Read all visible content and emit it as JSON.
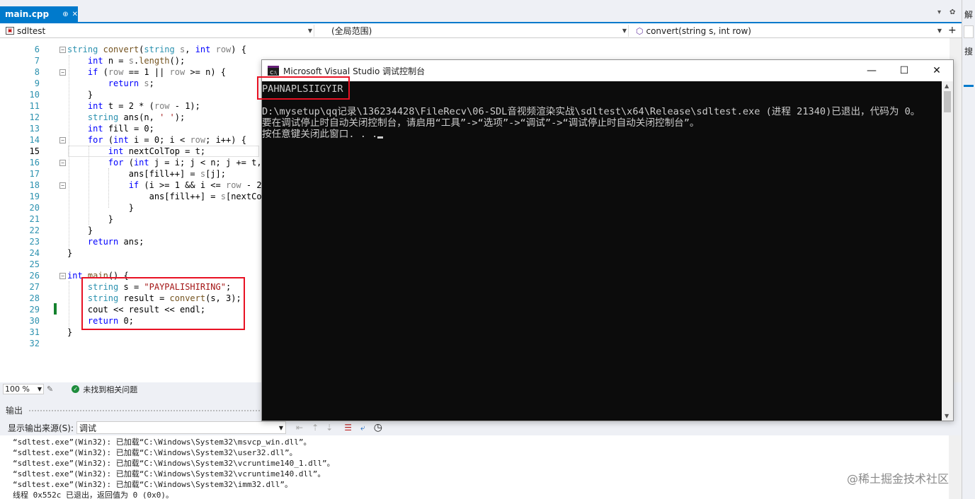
{
  "tab": {
    "title": "main.cpp",
    "pin": "⊕",
    "close": "✕"
  },
  "tabstrip_right": {
    "dropdown": "▾",
    "settings": "✿"
  },
  "navbar": {
    "project": "sdltest",
    "scope": "(全局范围)",
    "member": "convert(string s, int row)",
    "add": "+"
  },
  "code": {
    "line_numbers": [
      "6",
      "7",
      "8",
      "9",
      "10",
      "11",
      "12",
      "13",
      "14",
      "15",
      "16",
      "17",
      "18",
      "19",
      "20",
      "21",
      "22",
      "23",
      "24",
      "25",
      "26",
      "27",
      "28",
      "29",
      "30",
      "31",
      "32"
    ],
    "current_line": "15"
  },
  "editor_status": {
    "zoom": "100 %",
    "issues": "未找到相关问题"
  },
  "output": {
    "title": "输出",
    "source_label": "显示输出来源(S):",
    "source_value": "调试",
    "lines": [
      "“sdltest.exe”(Win32): 已加载“C:\\Windows\\System32\\msvcp_win.dll”。",
      "“sdltest.exe”(Win32): 已加载“C:\\Windows\\System32\\user32.dll”。",
      "“sdltest.exe”(Win32): 已加载“C:\\Windows\\System32\\vcruntime140_1.dll”。",
      "“sdltest.exe”(Win32): 已加载“C:\\Windows\\System32\\vcruntime140.dll”。",
      "“sdltest.exe”(Win32): 已加载“C:\\Windows\\System32\\imm32.dll”。",
      "线程 0x552c 已退出，返回值为 0 (0x0)。"
    ]
  },
  "side_panel": {
    "top": "解",
    "mid": "搜"
  },
  "console": {
    "title": "Microsoft Visual Studio 调试控制台",
    "icon": "C:\\",
    "minimize": "—",
    "maximize": "☐",
    "close": "✕",
    "output_line": "PAHNAPLSIIGYIR",
    "lines": [
      "D:\\mysetup\\qq记录\\136234428\\FileRecv\\06-SDL音视频渲染实战\\sdltest\\x64\\Release\\sdltest.exe (进程 21340)已退出，代码为 0。",
      "要在调试停止时自动关闭控制台，请启用“工具”->“选项”->“调试”->“调试停止时自动关闭控制台”。",
      "按任意键关闭此窗口. . ."
    ]
  },
  "watermark": "@稀土掘金技术社区",
  "colors": {
    "accent": "#007acc",
    "highlight_box": "#e81123",
    "console_bg": "#0c0c0c",
    "console_fg": "#cccccc",
    "change_bar": "#14822e"
  }
}
